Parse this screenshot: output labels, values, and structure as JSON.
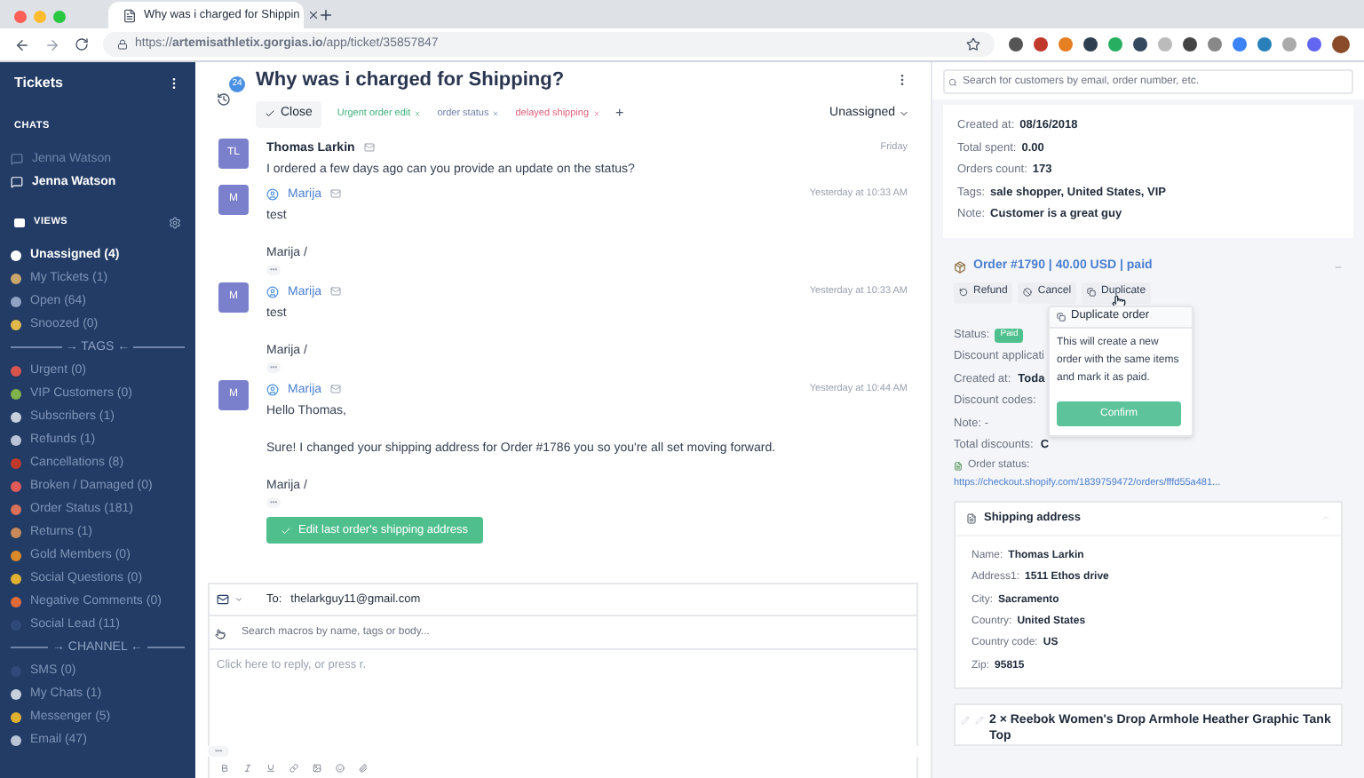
{
  "browser": {
    "tab_title": "Why was i charged for Shippin",
    "url": "https://**artemisathletix.gorgias.io**/app/ticket/35857847"
  },
  "sidebar": {
    "title": "Tickets",
    "chats_heading": "CHATS",
    "chats": [
      {
        "label": "Jenna Watson",
        "selected": false
      },
      {
        "label": "Jenna Watson",
        "selected": true
      }
    ],
    "views_heading": "VIEWS",
    "views": [
      {
        "kind": "item",
        "label": "Unassigned (4)",
        "selected": true,
        "color": "#ffffff"
      },
      {
        "kind": "item",
        "label": "My Tickets (1)",
        "selected": false,
        "color": "#c9a66b"
      },
      {
        "kind": "item",
        "label": "Open (64)",
        "selected": false,
        "color": "#8fa3c4"
      },
      {
        "kind": "item",
        "label": "Snoozed (0)",
        "selected": false,
        "color": "#e0b94a"
      },
      {
        "kind": "divider",
        "label": "→ TAGS ←"
      },
      {
        "kind": "item",
        "label": "Urgent (0)",
        "selected": false,
        "color": "#d9534f"
      },
      {
        "kind": "item",
        "label": "VIP Customers (0)",
        "selected": false,
        "color": "#7fb24a"
      },
      {
        "kind": "item",
        "label": "Subscribers (1)",
        "selected": false,
        "color": "#c8d0dc"
      },
      {
        "kind": "item",
        "label": "Refunds (1)",
        "selected": false,
        "color": "#b9c4d6"
      },
      {
        "kind": "item",
        "label": "Cancellations (8)",
        "selected": false,
        "color": "#c0392b"
      },
      {
        "kind": "item",
        "label": "Broken / Damaged (0)",
        "selected": false,
        "color": "#e05a5a"
      },
      {
        "kind": "item",
        "label": "Order Status (181)",
        "selected": false,
        "color": "#d9705a"
      },
      {
        "kind": "item",
        "label": "Returns (1)",
        "selected": false,
        "color": "#c98a5a"
      },
      {
        "kind": "item",
        "label": "Gold Members (0)",
        "selected": false,
        "color": "#d98a2b"
      },
      {
        "kind": "item",
        "label": "Social Questions (0)",
        "selected": false,
        "color": "#e0b030"
      },
      {
        "kind": "item",
        "label": "Negative Comments (0)",
        "selected": false,
        "color": "#e06a3a"
      },
      {
        "kind": "item",
        "label": "Social Lead (11)",
        "selected": false,
        "color": "#2f4a78"
      },
      {
        "kind": "divider",
        "label": "→ CHANNEL ←"
      },
      {
        "kind": "item",
        "label": "SMS (0)",
        "selected": false,
        "color": "#2f4a78"
      },
      {
        "kind": "item",
        "label": "My Chats (1)",
        "selected": false,
        "color": "#c8d0dc"
      },
      {
        "kind": "item",
        "label": "Messenger (5)",
        "selected": false,
        "color": "#e0b030"
      },
      {
        "kind": "item",
        "label": "Email (47)",
        "selected": false,
        "color": "#b9c4d6"
      }
    ]
  },
  "ticket": {
    "badge": "24",
    "title": "Why was i charged for Shipping?",
    "close": "Close",
    "tags": [
      {
        "label": "Urgent order edit",
        "color": "#3fb07a"
      },
      {
        "label": "order status",
        "color": "#6d7fa8"
      },
      {
        "label": "delayed shipping",
        "color": "#e0607a"
      }
    ],
    "add": "+",
    "assignee": "Unassigned",
    "messages": [
      {
        "kind": "customer",
        "avatar": "TL",
        "author": "Thomas Larkin",
        "time": "Friday",
        "paragraphs": [
          "I ordered a few days ago can you provide an update on the status?"
        ]
      },
      {
        "kind": "agent",
        "avatar": "M",
        "author": "Marija",
        "time": "Yesterday at 10:33 AM",
        "paragraphs": [
          "test",
          "Marija /"
        ],
        "more": "•••"
      },
      {
        "kind": "agent",
        "avatar": "M",
        "author": "Marija",
        "time": "Yesterday at 10:33 AM",
        "paragraphs": [
          "test",
          "Marija /"
        ],
        "more": "•••"
      },
      {
        "kind": "agent",
        "avatar": "M",
        "author": "Marija",
        "time": "Yesterday at 10:44 AM",
        "paragraphs": [
          "Hello Thomas,",
          "Sure! I changed your shipping address for Order #1786 you so you're all set moving forward.",
          "Marija /"
        ],
        "more": "•••",
        "action": "Edit last order's shipping address"
      }
    ],
    "composer": {
      "to_label": "To:",
      "to": "thelarkguy11@gmail.com",
      "macro_placeholder": "Search macros by name, tags or body...",
      "reply_placeholder": "Click here to reply, or press r.",
      "more": "•••"
    }
  },
  "customer": {
    "search_placeholder": "Search for customers by email, order number, etc.",
    "fields": [
      {
        "label": "Created at:",
        "value": "08/16/2018"
      },
      {
        "label": "Total spent:",
        "value": "0.00"
      },
      {
        "label": "Orders count:",
        "value": "173"
      },
      {
        "label": "Tags:",
        "value": "sale shopper, United States, VIP"
      },
      {
        "label": "Note:",
        "value": "Customer is a great guy"
      }
    ]
  },
  "order": {
    "title": "Order #1790 | 40.00 USD | paid",
    "actions": [
      {
        "kind": "refund",
        "label": "Refund"
      },
      {
        "kind": "cancel",
        "label": "Cancel"
      },
      {
        "kind": "duplicate",
        "label": "Duplicate"
      }
    ],
    "status_label": "Status:",
    "status": "Paid",
    "details": [
      {
        "label": "Discount applicati"
      },
      {
        "label": "Created at:",
        "value": "Toda"
      },
      {
        "label": "Discount codes:"
      },
      {
        "label": "Note: -"
      },
      {
        "label": "Total discounts:",
        "value": "C"
      }
    ],
    "status_link_label": "Order status:",
    "status_link": "https://checkout.shopify.com/1839759472/orders/fffd55a481...",
    "popover": {
      "title": "Duplicate order",
      "text": "This will create a new order with the same items and mark it as paid.",
      "confirm": "Confirm"
    }
  },
  "shipping": {
    "title": "Shipping address",
    "fields": [
      {
        "label": "Name:",
        "value": "Thomas Larkin"
      },
      {
        "label": "Address1:",
        "value": "1511 Ethos drive"
      },
      {
        "label": "City:",
        "value": "Sacramento"
      },
      {
        "label": "Country:",
        "value": "United States"
      },
      {
        "label": "Country code:",
        "value": "US"
      },
      {
        "label": "Zip:",
        "value": "95815"
      }
    ]
  },
  "product": {
    "title": "2 × Reebok Women's Drop Armhole Heather Graphic Tank Top"
  }
}
